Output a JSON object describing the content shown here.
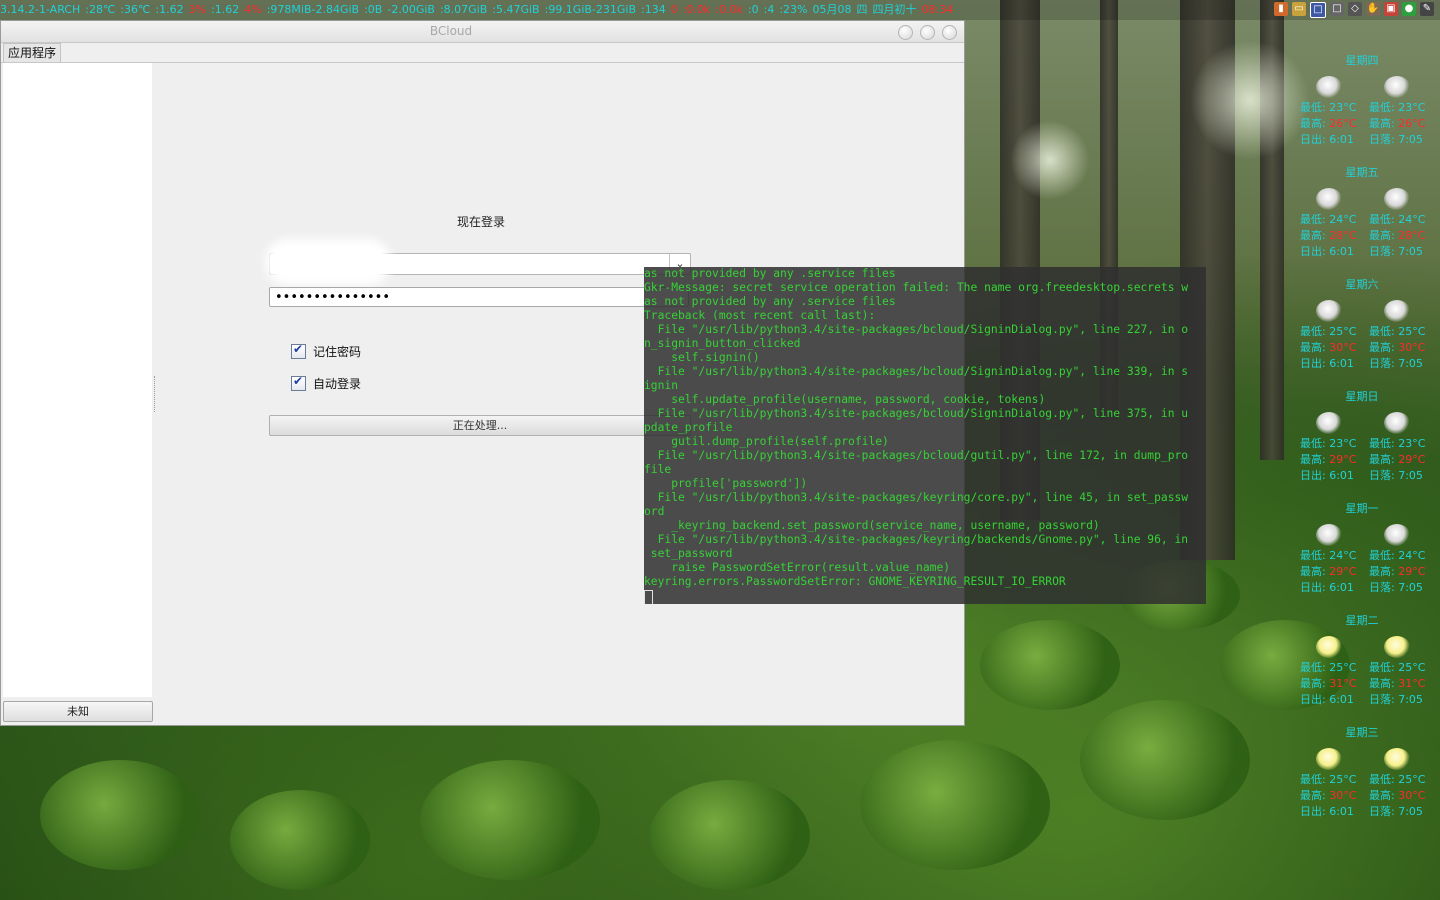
{
  "top_panel": {
    "segments": [
      {
        "text": "3.14.2-1-ARCH",
        "color": "cyan"
      },
      {
        "text": ":28℃",
        "color": "cyan"
      },
      {
        "text": ":36℃",
        "color": "cyan"
      },
      {
        "text": ":1.62",
        "color": "cyan"
      },
      {
        "text": "3%",
        "color": "red"
      },
      {
        "text": ":1.62",
        "color": "cyan"
      },
      {
        "text": "4%",
        "color": "red"
      },
      {
        "text": ":978MiB-2.84GiB",
        "color": "cyan"
      },
      {
        "text": ":0B",
        "color": "cyan"
      },
      {
        "text": "-2.00GiB",
        "color": "cyan"
      },
      {
        "text": ":8.07GiB",
        "color": "cyan"
      },
      {
        "text": ":5.47GiB",
        "color": "cyan"
      },
      {
        "text": ":99.1GiB-231GiB",
        "color": "cyan"
      },
      {
        "text": ":134",
        "color": "cyan"
      },
      {
        "text": "0",
        "color": "red"
      },
      {
        "text": ":0.0k",
        "color": "red"
      },
      {
        "text": ":0.0k",
        "color": "red"
      },
      {
        "text": ":0",
        "color": "cyan"
      },
      {
        "text": ":4",
        "color": "cyan"
      },
      {
        "text": ":23%",
        "color": "cyan"
      },
      {
        "text": "05月08",
        "color": "cyan"
      },
      {
        "text": "四",
        "color": "cyan"
      },
      {
        "text": "四月初十",
        "color": "cyan"
      },
      {
        "text": "08:34",
        "color": "red"
      }
    ]
  },
  "window": {
    "title": "BCloud",
    "menu_apps": "应用程序",
    "sidebar_button": "未知",
    "login_title": "现在登录",
    "username_value": "",
    "password_mask": "•••••••••••••••",
    "remember_password": "记住密码",
    "auto_login": "自动登录",
    "processing_button": "正在处理..."
  },
  "terminal": {
    "lines": [
      "as not provided by any .service files",
      "Gkr-Message: secret service operation failed: The name org.freedesktop.secrets w",
      "as not provided by any .service files",
      "Traceback (most recent call last):",
      "  File \"/usr/lib/python3.4/site-packages/bcloud/SigninDialog.py\", line 227, in o",
      "n_signin_button_clicked",
      "    self.signin()",
      "  File \"/usr/lib/python3.4/site-packages/bcloud/SigninDialog.py\", line 339, in s",
      "ignin",
      "    self.update_profile(username, password, cookie, tokens)",
      "  File \"/usr/lib/python3.4/site-packages/bcloud/SigninDialog.py\", line 375, in u",
      "pdate_profile",
      "    gutil.dump_profile(self.profile)",
      "  File \"/usr/lib/python3.4/site-packages/bcloud/gutil.py\", line 172, in dump_pro",
      "file",
      "    profile['password'])",
      "  File \"/usr/lib/python3.4/site-packages/keyring/core.py\", line 45, in set_passw",
      "ord",
      "    _keyring_backend.set_password(service_name, username, password)",
      "  File \"/usr/lib/python3.4/site-packages/keyring/backends/Gnome.py\", line 96, in",
      " set_password",
      "    raise PasswordSetError(result.value_name)",
      "keyring.errors.PasswordSetError: GNOME_KEYRING_RESULT_IO_ERROR"
    ]
  },
  "weather": {
    "labels": {
      "low": "最低:",
      "high": "最高:",
      "sunrise": "日出:",
      "sunset": "日落:"
    },
    "days": [
      {
        "name": "星期四",
        "low": "23°C",
        "high": "26°C",
        "sunrise": "6:01",
        "sunset": "7:05",
        "icon": "thunderstorm"
      },
      {
        "name": "星期五",
        "low": "24°C",
        "high": "28°C",
        "sunrise": "6:01",
        "sunset": "7:05",
        "icon": "thunderstorm"
      },
      {
        "name": "星期六",
        "low": "25°C",
        "high": "30°C",
        "sunrise": "6:01",
        "sunset": "7:05",
        "icon": "thunderstorm"
      },
      {
        "name": "星期日",
        "low": "23°C",
        "high": "29°C",
        "sunrise": "6:01",
        "sunset": "7:05",
        "icon": "thunderstorm"
      },
      {
        "name": "星期一",
        "low": "24°C",
        "high": "29°C",
        "sunrise": "6:01",
        "sunset": "7:05",
        "icon": "thunderstorm"
      },
      {
        "name": "星期二",
        "low": "25°C",
        "high": "31°C",
        "sunrise": "6:01",
        "sunset": "7:05",
        "icon": "sunny-thunder"
      },
      {
        "name": "星期三",
        "low": "25°C",
        "high": "30°C",
        "sunrise": "6:01",
        "sunset": "7:05",
        "icon": "sunny-thunder"
      }
    ]
  }
}
